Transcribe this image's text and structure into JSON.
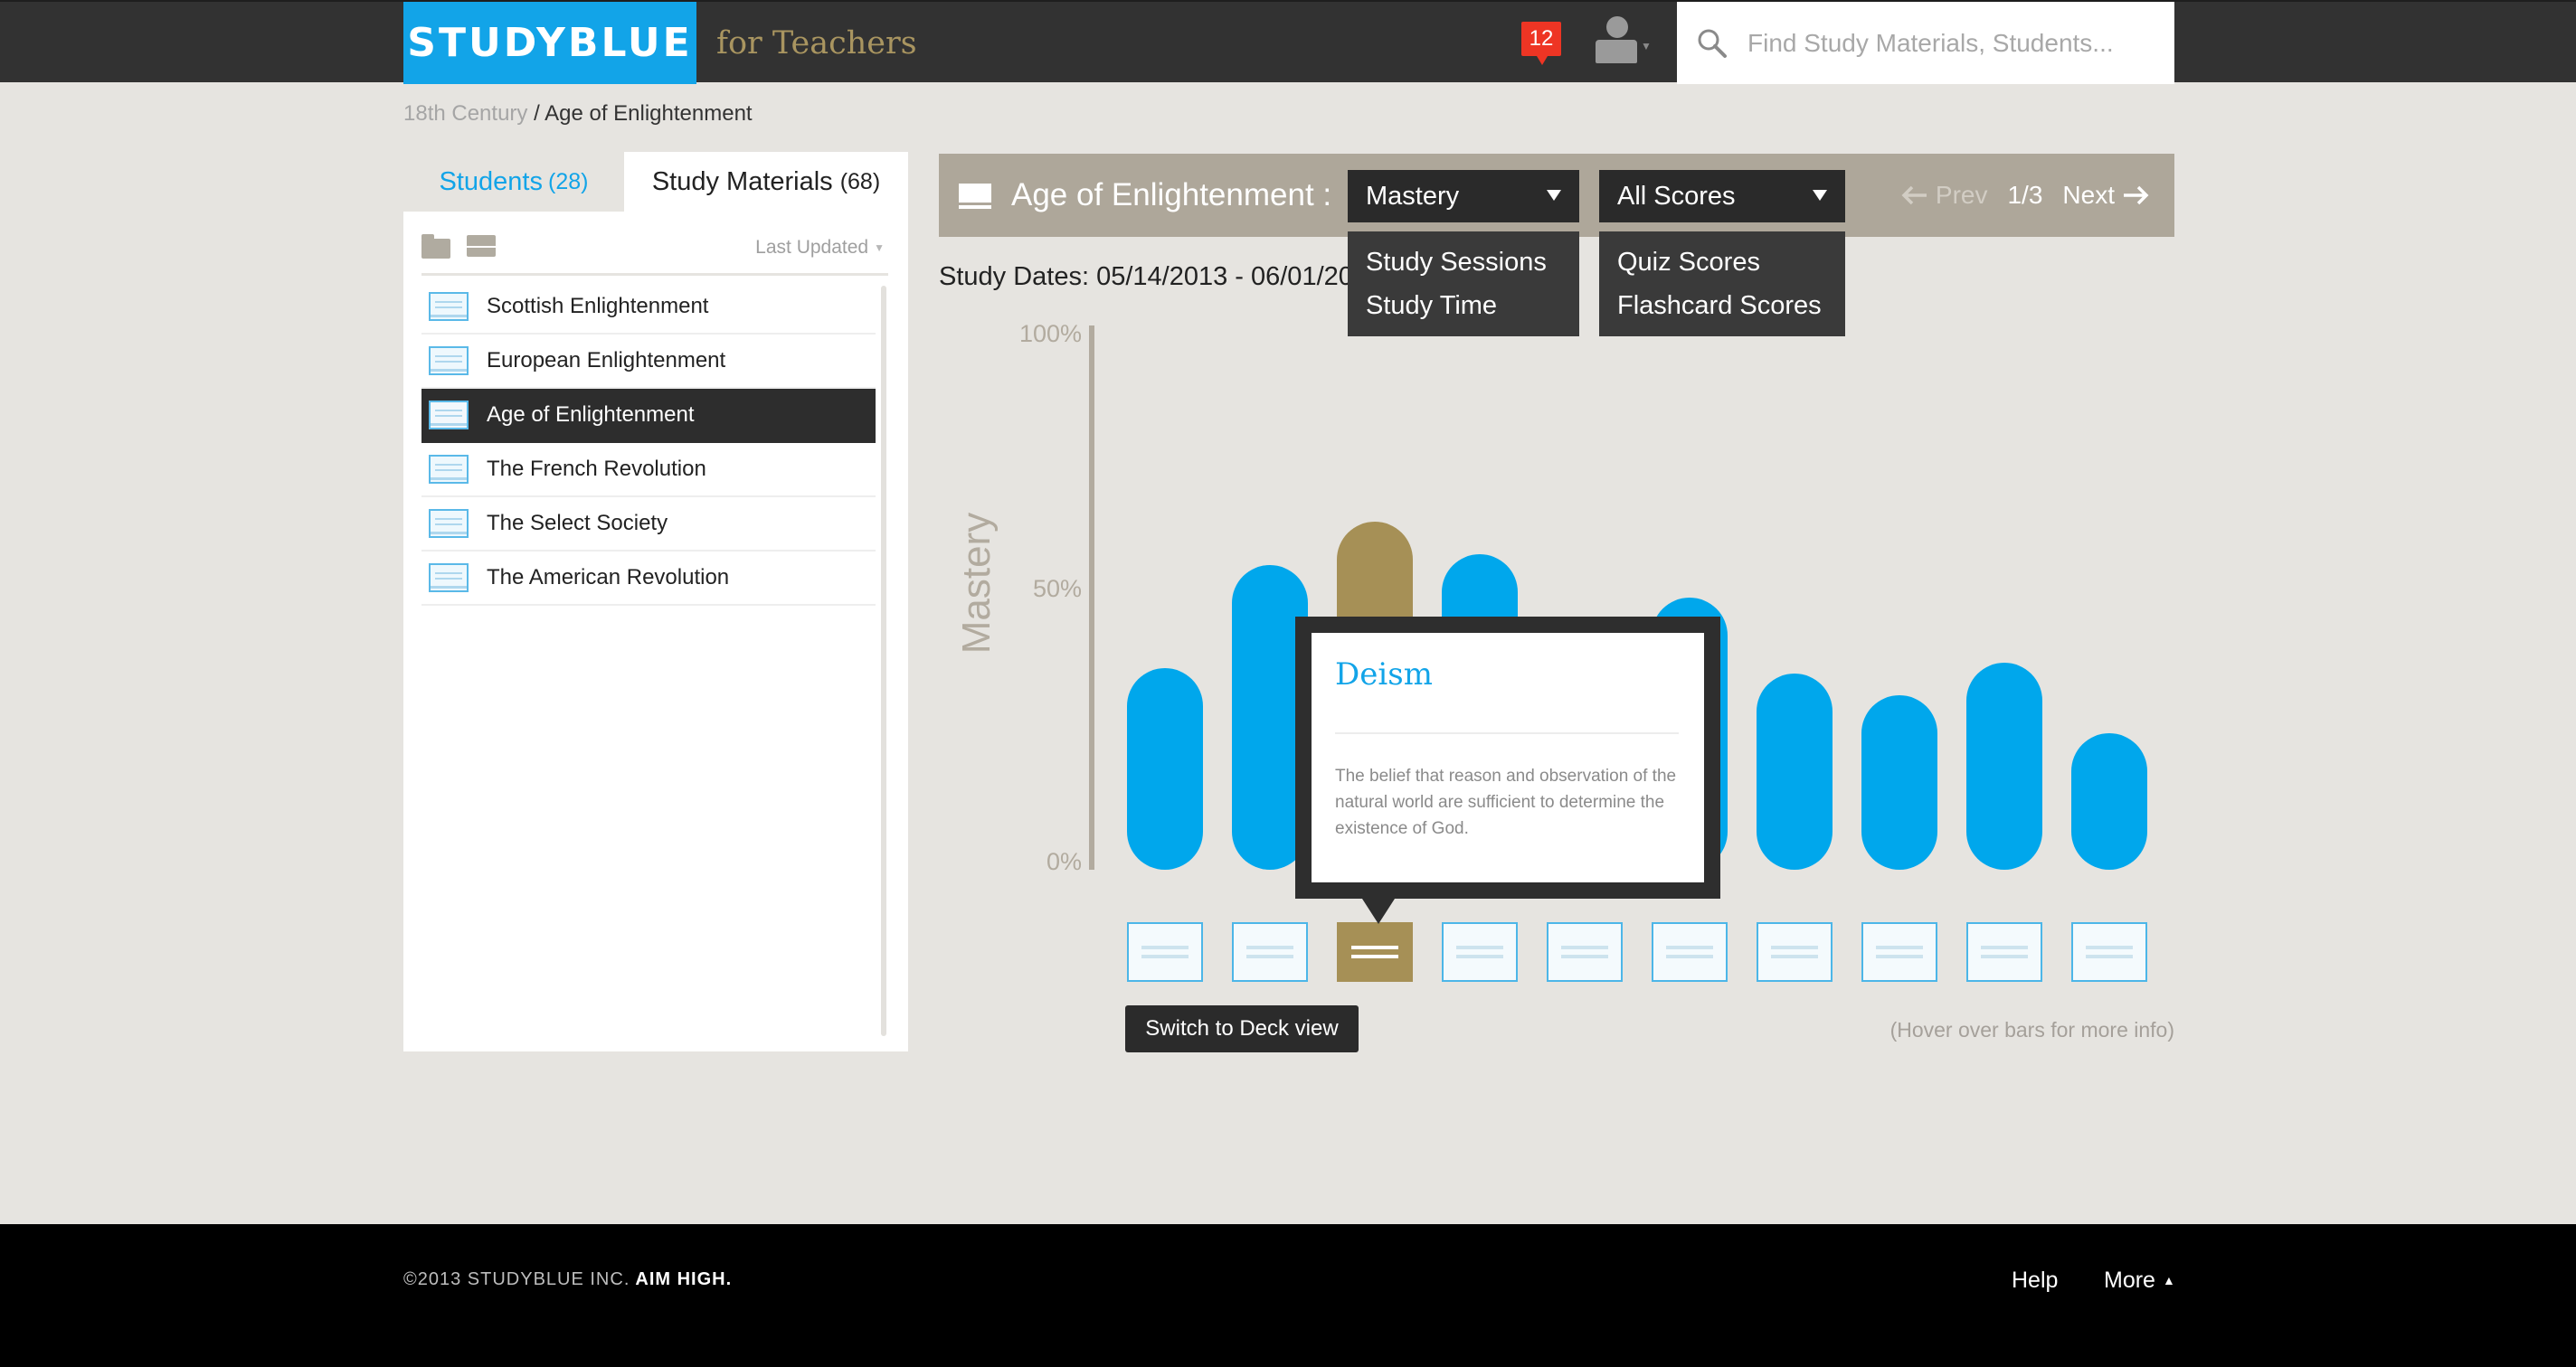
{
  "header": {
    "logo": "STUDYBLUE",
    "subtitle": "for Teachers",
    "notification_count": "12",
    "search_placeholder": "Find Study Materials, Students..."
  },
  "breadcrumb": {
    "parent": "18th Century",
    "separator": " / ",
    "current": "Age of Enlightenment"
  },
  "sidebar": {
    "tabs": [
      {
        "label": "Students",
        "count": "(28)"
      },
      {
        "label": "Study Materials",
        "count": "(68)"
      }
    ],
    "sort_label": "Last Updated",
    "items": [
      {
        "label": "Scottish Enlightenment"
      },
      {
        "label": "European Enlightenment"
      },
      {
        "label": "Age of Enlightenment"
      },
      {
        "label": "The French Revolution"
      },
      {
        "label": "The Select Society"
      },
      {
        "label": "The American Revolution"
      }
    ]
  },
  "main": {
    "deck_title": "Age of Enlightenment :",
    "metric_dropdown": {
      "selected": "Mastery",
      "options": [
        "Study Sessions",
        "Study Time"
      ]
    },
    "score_dropdown": {
      "selected": "All Scores",
      "options": [
        "Quiz Scores",
        "Flashcard Scores"
      ]
    },
    "pager": {
      "prev": "Prev",
      "page": "1/3",
      "next": "Next"
    },
    "study_dates": "Study Dates: 05/14/2013 - 06/01/2013",
    "tooltip": {
      "title": "Deism",
      "text": "The belief that reason and observation of the natural world are sufficient to determine the existence of God."
    },
    "switch_button": "Switch to Deck view",
    "hover_hint": "(Hover over bars for more info)"
  },
  "chart_data": {
    "type": "bar",
    "ylabel": "Mastery",
    "y_ticks": [
      "100%",
      "50%",
      "0%"
    ],
    "ylim": [
      0,
      100
    ],
    "values": [
      37,
      56,
      64,
      58,
      44,
      50,
      36,
      32,
      38,
      25
    ],
    "active_index": 2,
    "colors": {
      "bar": "#00a7ec",
      "active": "#a69056"
    }
  },
  "footer": {
    "copyright": "©2013 STUDYBLUE INC.",
    "tagline": "AIM HIGH.",
    "help": "Help",
    "more": "More"
  },
  "colors": {
    "brand": "#12a4e8",
    "accent": "#a69056",
    "alert": "#ee3524"
  }
}
